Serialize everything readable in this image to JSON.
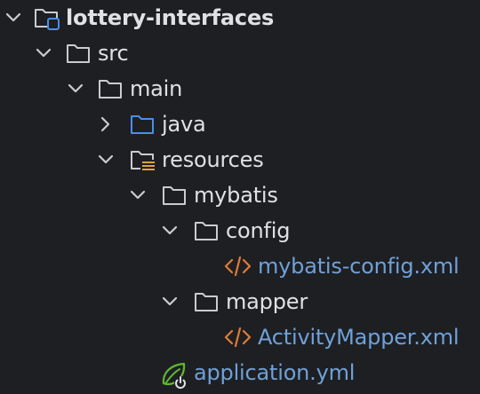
{
  "project_tree": {
    "root": {
      "label": "lottery-interfaces",
      "icon": "module-folder-icon",
      "expanded": true
    },
    "src": {
      "label": "src",
      "icon": "folder-icon",
      "expanded": true
    },
    "main": {
      "label": "main",
      "icon": "folder-icon",
      "expanded": true
    },
    "java": {
      "label": "java",
      "icon": "source-root-folder-icon",
      "expanded": false
    },
    "resources": {
      "label": "resources",
      "icon": "resources-root-folder-icon",
      "expanded": true
    },
    "mybatis": {
      "label": "mybatis",
      "icon": "folder-icon",
      "expanded": true
    },
    "config": {
      "label": "config",
      "icon": "folder-icon",
      "expanded": true
    },
    "mybatis_config": {
      "label": "mybatis-config.xml",
      "icon": "xml-file-icon"
    },
    "mapper": {
      "label": "mapper",
      "icon": "folder-icon",
      "expanded": true
    },
    "activity_mapper": {
      "label": "ActivityMapper.xml",
      "icon": "xml-file-icon"
    },
    "application_yml": {
      "label": "application.yml",
      "icon": "spring-config-icon"
    }
  },
  "colors": {
    "background": "#1e1f22",
    "text": "#dfe1e5",
    "file_link": "#6ea1d9",
    "folder_stroke": "#c9ccd1",
    "source_folder": "#4a8fe8",
    "xml_icon": "#e07b39",
    "spring_icon": "#5fb832",
    "resources_marker": "#d9a343"
  }
}
